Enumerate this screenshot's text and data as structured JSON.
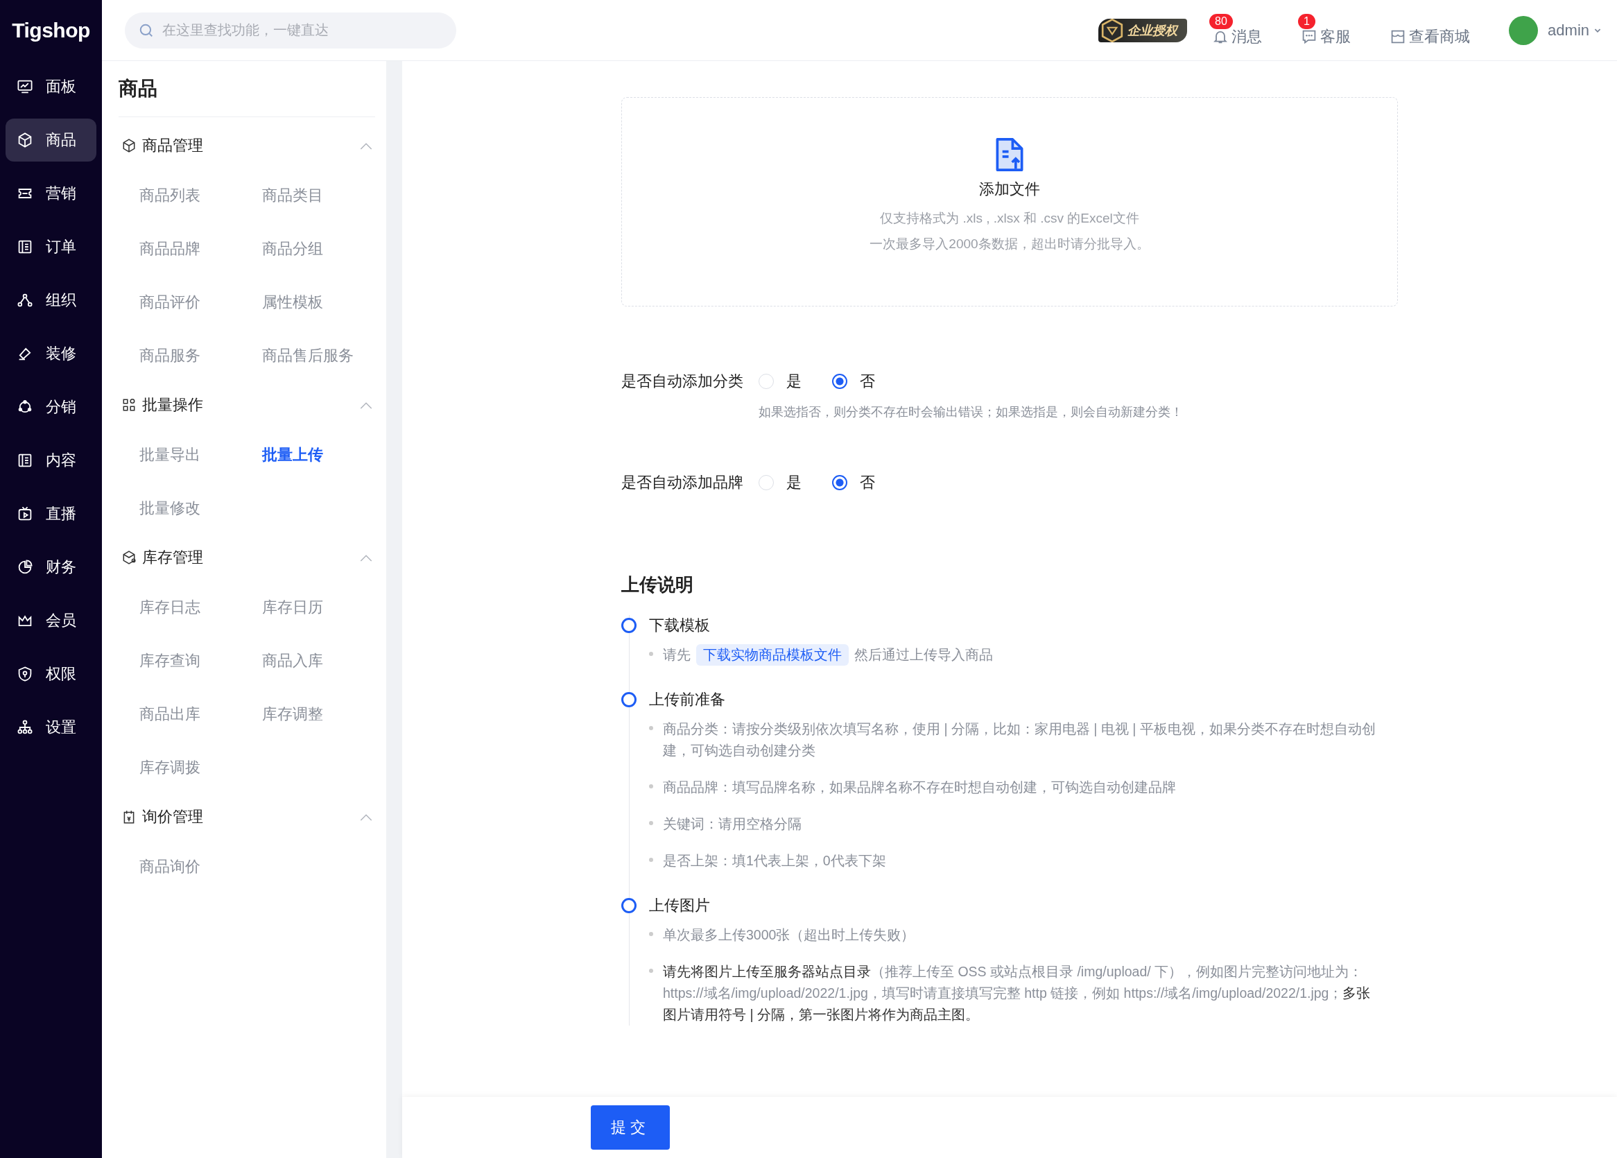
{
  "logo": "Tigshop",
  "search": {
    "placeholder": "在这里查找功能，一键直达"
  },
  "header": {
    "license": "企业授权",
    "links": [
      {
        "kind": "bell",
        "label": "消息",
        "badge": "80"
      },
      {
        "kind": "chat",
        "label": "客服",
        "badge": "1"
      },
      {
        "kind": "store",
        "label": "查看商城"
      }
    ],
    "user": "admin"
  },
  "nav": [
    {
      "label": "面板",
      "selected": false
    },
    {
      "label": "商品",
      "selected": true
    },
    {
      "label": "营销",
      "selected": false
    },
    {
      "label": "订单",
      "selected": false
    },
    {
      "label": "组织",
      "selected": false
    },
    {
      "label": "装修",
      "selected": false
    },
    {
      "label": "分销",
      "selected": false
    },
    {
      "label": "内容",
      "selected": false
    },
    {
      "label": "直播",
      "selected": false
    },
    {
      "label": "财务",
      "selected": false
    },
    {
      "label": "会员",
      "selected": false
    },
    {
      "label": "权限",
      "selected": false
    },
    {
      "label": "设置",
      "selected": false
    }
  ],
  "subnav": {
    "title": "商品",
    "groups": [
      {
        "title": "商品管理",
        "expanded": true,
        "items": [
          {
            "label": "商品列表",
            "selected": false
          },
          {
            "label": "商品类目",
            "selected": false
          },
          {
            "label": "商品品牌",
            "selected": false
          },
          {
            "label": "商品分组",
            "selected": false
          },
          {
            "label": "商品评价",
            "selected": false
          },
          {
            "label": "属性模板",
            "selected": false
          },
          {
            "label": "商品服务",
            "selected": false
          },
          {
            "label": "商品售后服务",
            "selected": false
          }
        ]
      },
      {
        "title": "批量操作",
        "expanded": true,
        "items": [
          {
            "label": "批量导出",
            "selected": false
          },
          {
            "label": "批量上传",
            "selected": true
          },
          {
            "label": "批量修改",
            "selected": false
          }
        ]
      },
      {
        "title": "库存管理",
        "expanded": true,
        "items": [
          {
            "label": "库存日志",
            "selected": false
          },
          {
            "label": "库存日历",
            "selected": false
          },
          {
            "label": "库存查询",
            "selected": false
          },
          {
            "label": "商品入库",
            "selected": false
          },
          {
            "label": "商品出库",
            "selected": false
          },
          {
            "label": "库存调整",
            "selected": false
          },
          {
            "label": "库存调拨",
            "selected": false
          }
        ]
      },
      {
        "title": "询价管理",
        "expanded": true,
        "items": [
          {
            "label": "商品询价",
            "selected": false
          }
        ]
      }
    ]
  },
  "upload": {
    "title": "添加文件",
    "hints": [
      "仅支持格式为 .xls , .xlsx 和 .csv 的Excel文件",
      "一次最多导入2000条数据，超出时请分批导入。"
    ]
  },
  "options": [
    {
      "label": "是否自动添加分类",
      "choices": [
        {
          "label": "是",
          "selected": false
        },
        {
          "label": "否",
          "selected": true
        }
      ],
      "hint": "如果选指否，则分类不存在时会输出错误；如果选指是，则会自动新建分类！"
    },
    {
      "label": "是否自动添加品牌",
      "choices": [
        {
          "label": "是",
          "selected": false
        },
        {
          "label": "否",
          "selected": true
        }
      ]
    }
  ],
  "instructions": {
    "title": "上传说明",
    "steps": [
      {
        "title": "下载模板",
        "bullets": [
          {
            "kind": "link",
            "prefix": "请先",
            "link": "下载实物商品模板文件",
            "suffix": "然后通过上传导入商品"
          }
        ]
      },
      {
        "title": "上传前准备",
        "bullets": [
          {
            "kind": "text",
            "text": "商品分类：请按分类级别依次填写名称，使用 | 分隔，比如：家用电器 | 电视 | 平板电视，如果分类不存在时想自动创建，可钩选自动创建分类"
          },
          {
            "kind": "text",
            "text": "商品品牌：填写品牌名称，如果品牌名称不存在时想自动创建，可钩选自动创建品牌"
          },
          {
            "kind": "text",
            "text": "关键词：请用空格分隔"
          },
          {
            "kind": "text",
            "text": "是否上架：填1代表上架，0代表下架"
          }
        ]
      },
      {
        "title": "上传图片",
        "bullets": [
          {
            "kind": "text",
            "text": "单次最多上传3000张（超出时上传失败）"
          },
          {
            "kind": "text",
            "text": "**请先将图片上传至服务器站点目录**（推荐上传至 OSS 或站点根目录 /img/upload/ 下），例如图片完整访问地址为：https://域名/img/upload/2022/1.jpg，填写时请直接填写完整 http 链接，例如 https://域名/img/upload/2022/1.jpg；**多张图片请用符号 | 分隔，第一张图片将作为商品主图。**"
          }
        ]
      }
    ]
  },
  "submit": "提交"
}
